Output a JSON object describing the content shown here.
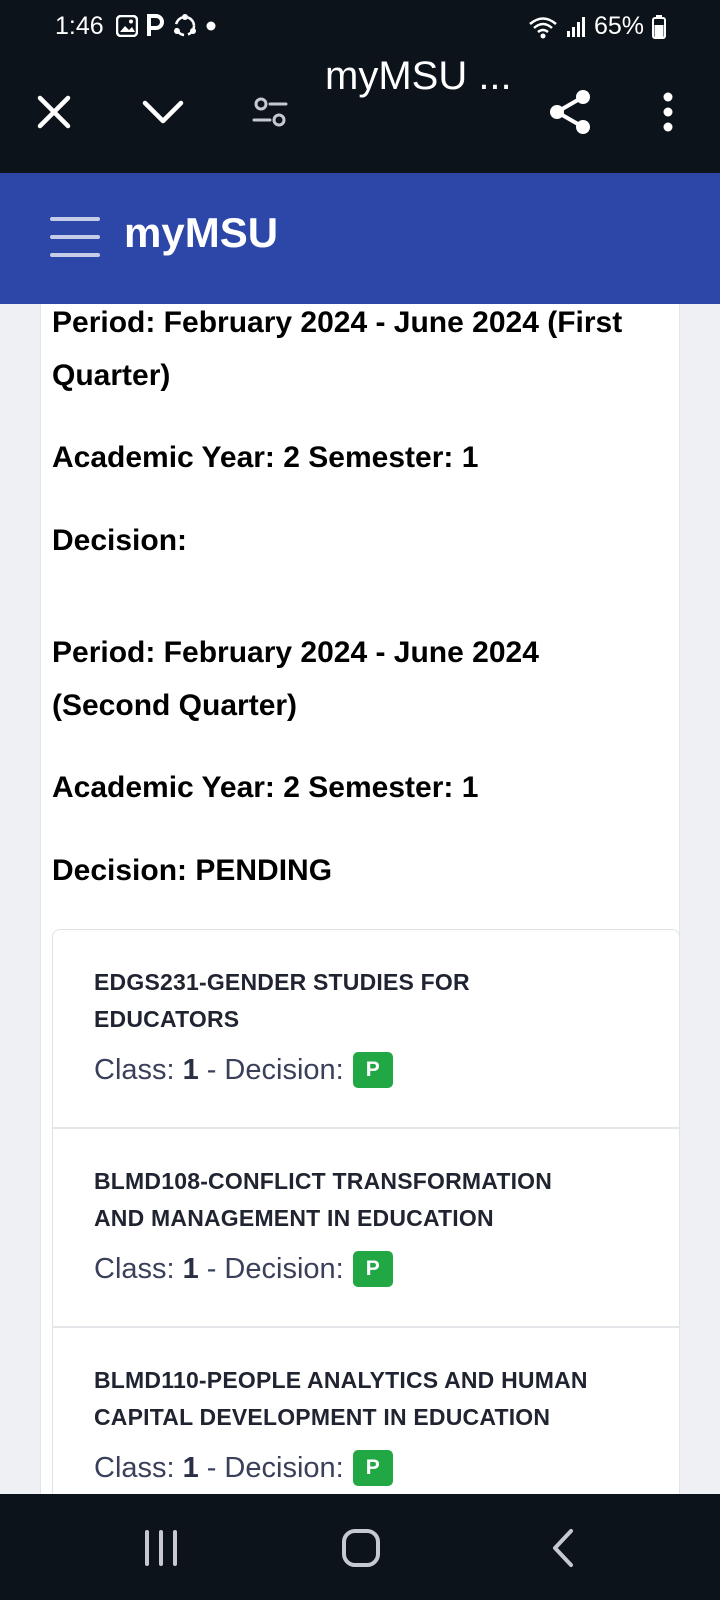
{
  "status_bar": {
    "time": "1:46",
    "battery": "65%",
    "icons": [
      "gallery-icon",
      "parking-icon",
      "sync-icon",
      "dot-icon",
      "wifi-icon",
      "signal-icon",
      "battery-icon"
    ]
  },
  "browser": {
    "title": "myMSU ...",
    "icons": [
      "close-icon",
      "chevron-down-icon",
      "settings-sliders-icon",
      "share-icon",
      "more-vertical-icon"
    ]
  },
  "app": {
    "title": "myMSU"
  },
  "periods": [
    {
      "period": "Period: February 2024 - June 2024 (First Quarter)",
      "period_line1": "Period: February 2024 - June 2024 (First",
      "period_line2": "Quarter)",
      "year_semester": "Academic Year: 2 Semester: 1",
      "decision": "Decision:"
    },
    {
      "period": "Period: February 2024 - June 2024 (Second Quarter)",
      "period_line1": "Period: February 2024 - June 2024",
      "period_line2": "(Second Quarter)",
      "year_semester": "Academic Year: 2 Semester: 1",
      "decision": "Decision: PENDING"
    }
  ],
  "courses": [
    {
      "title_line1": "EDGS231-GENDER STUDIES FOR",
      "title_line2": "EDUCATORS",
      "class_label": "Class:",
      "class_value": "1",
      "decision_label": "- Decision:",
      "decision_badge": "P"
    },
    {
      "title_line1": "BLMD108-CONFLICT TRANSFORMATION",
      "title_line2": "AND MANAGEMENT IN EDUCATION",
      "class_label": "Class:",
      "class_value": "1",
      "decision_label": "- Decision:",
      "decision_badge": "P"
    },
    {
      "title_line1": "BLMD110-PEOPLE ANALYTICS AND HUMAN",
      "title_line2": "CAPITAL DEVELOPMENT IN EDUCATION",
      "class_label": "Class:",
      "class_value": "1",
      "decision_label": "- Decision:",
      "decision_badge": "P"
    }
  ],
  "colors": {
    "app_header": "#2c47a7",
    "chrome_dark": "#0c131b",
    "badge_green": "#22a745"
  }
}
